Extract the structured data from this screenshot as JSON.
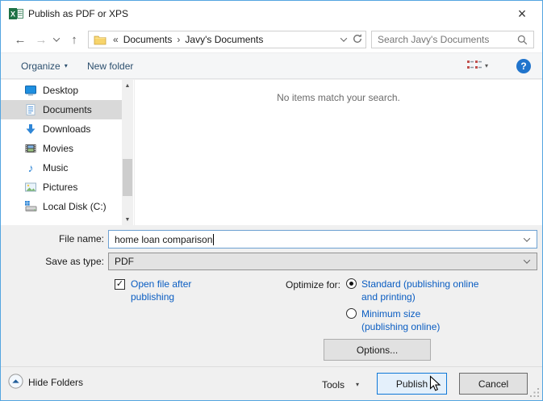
{
  "window": {
    "title": "Publish as PDF or XPS"
  },
  "colors": {
    "window_border": "#54a5e0",
    "accent_link_blue": "#0a5dc2",
    "publish_button_border": "#0f78d7",
    "publish_button_bg": "#e4f0fb",
    "toolbar_text": "#2c4f6e",
    "selected_sidebar_bg": "#d9d9d9",
    "excel_green": "#1e7145",
    "help_circle_blue": "#2074cc"
  },
  "icons": {
    "back": "←",
    "forward": "→",
    "up": "↑",
    "close": "×",
    "breadcrumb_collapsed": "«",
    "breadcrumb_separator": "›",
    "caret_down": "▾",
    "scroll_up": "▲",
    "scroll_down": "▼",
    "check": "✓",
    "music_note": "♪",
    "help": "?"
  },
  "navbar": {
    "breadcrumb": {
      "items": [
        "Documents",
        "Javy's Documents"
      ]
    },
    "search_placeholder": "Search Javy's Documents"
  },
  "toolbar": {
    "organize_label": "Organize",
    "new_folder_label": "New folder"
  },
  "sidebar": {
    "items": [
      {
        "label": "Desktop",
        "selected": false
      },
      {
        "label": "Documents",
        "selected": true
      },
      {
        "label": "Downloads",
        "selected": false
      },
      {
        "label": "Movies",
        "selected": false
      },
      {
        "label": "Music",
        "selected": false
      },
      {
        "label": "Pictures",
        "selected": false
      },
      {
        "label": "Local Disk (C:)",
        "selected": false
      }
    ]
  },
  "main": {
    "empty_message": "No items match your search."
  },
  "form": {
    "file_name_label": "File name:",
    "file_name_value": "home loan comparison",
    "save_as_type_label": "Save as type:",
    "save_as_type_value": "PDF",
    "open_file_checkbox_label": "Open file after publishing",
    "open_file_checked": true,
    "optimize_for_label": "Optimize for:",
    "optimize_options": [
      {
        "label": "Standard (publishing online and printing)",
        "selected": true
      },
      {
        "label": "Minimum size (publishing online)",
        "selected": false
      }
    ],
    "options_button_label": "Options..."
  },
  "footer": {
    "hide_folders_label": "Hide Folders",
    "tools_label": "Tools",
    "publish_label": "Publish",
    "cancel_label": "Cancel"
  }
}
